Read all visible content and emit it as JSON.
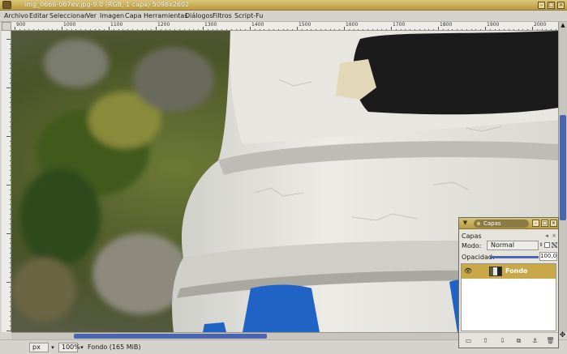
{
  "window": {
    "title": "img_0666-067ev.jpg-9.0 (RGB, 1 capa) 5098x2602",
    "icons": {
      "app": "gimp-icon",
      "minimize": "minimize-icon",
      "maximize": "maximize-icon",
      "close": "close-icon"
    }
  },
  "menubar": {
    "items": [
      "Archivo",
      "Editar",
      "Seleccionar",
      "Ver",
      "Imagen",
      "Capa",
      "Herramientas",
      "Diálogos",
      "Filtros",
      "Script-Fu"
    ]
  },
  "ruler": {
    "horizontal_labels": [
      "900",
      "1000",
      "1100",
      "1200",
      "1300",
      "1400",
      "1500",
      "1600",
      "1700",
      "1800",
      "1900",
      "2000"
    ]
  },
  "canvas": {
    "image_description_colors": {
      "wall": "#e9e8e2",
      "black_paint": "#1b1b1b",
      "blue_paint": "#1f63c4",
      "foliage": "#4d5a2a"
    }
  },
  "statusbar": {
    "unit": "px",
    "zoom": "100%",
    "info": "Fondo (165 MiB)"
  },
  "layers_dialog": {
    "tab_label": "Capas",
    "heading": "Capas",
    "mode_label": "Modo:",
    "mode_value": "Normal",
    "opacity_label": "Opacidad:",
    "opacity_value": "100,0",
    "opacity_fraction": 1.0,
    "layers": [
      {
        "name": "Fondo",
        "visible": true,
        "selected": true
      }
    ],
    "accent_color": "#c9a84a"
  }
}
